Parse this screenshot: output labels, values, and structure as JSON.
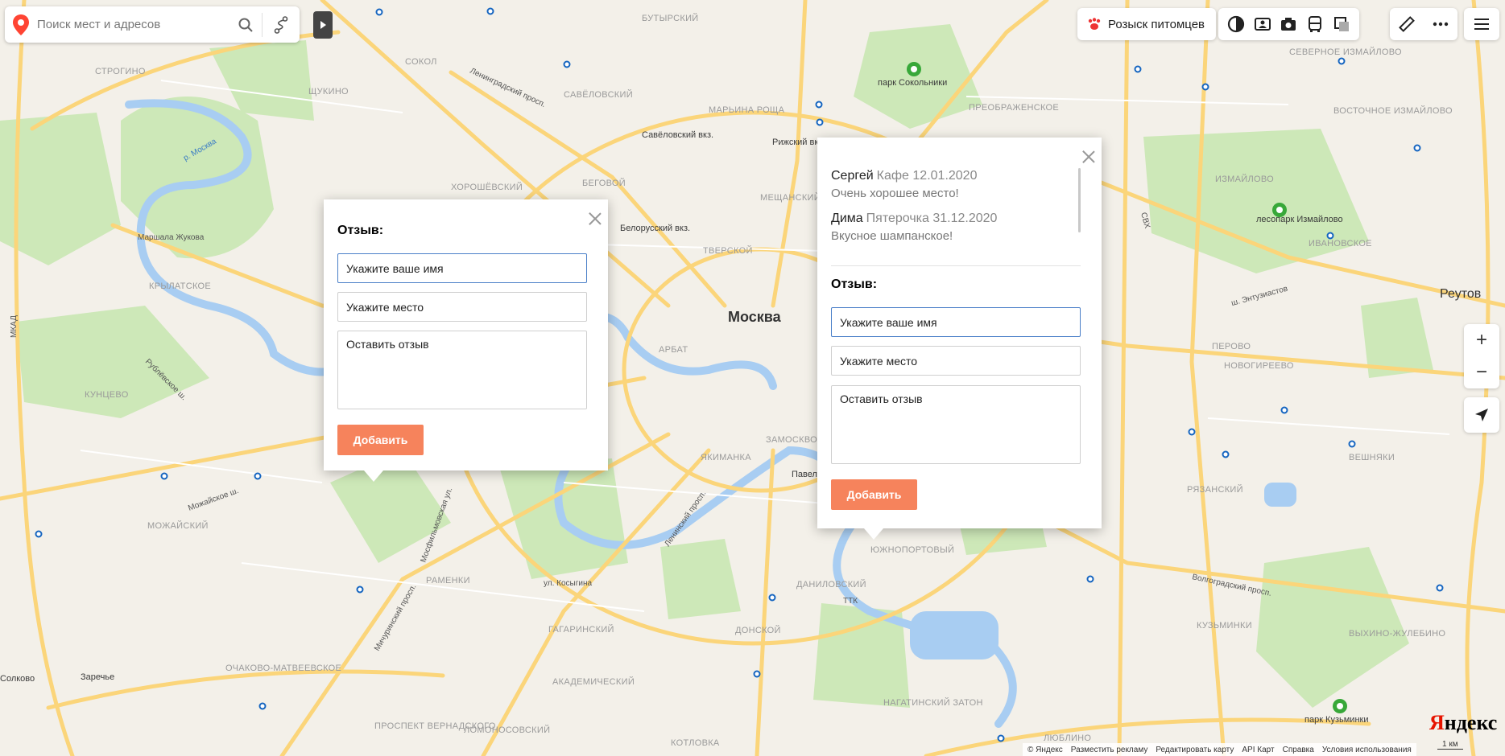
{
  "search": {
    "placeholder": "Поиск мест и адресов"
  },
  "top_right": {
    "pets_label": "Розыск питомцев"
  },
  "map": {
    "city_label": "Москва",
    "district_labels": [
      "СТРОГИНО",
      "ЩУКИНО",
      "СОКОЛ",
      "САВЁЛОВСКИЙ",
      "МАРЬИНА РОЩА",
      "БУТЫРСКИЙ",
      "СЕВЕРНОЕ ИЗМАЙЛОВО",
      "ХОРОШЁВСКИЙ",
      "БЕГОВОЙ",
      "МЕЩАНСКИЙ",
      "ТВЕРСКОЙ",
      "ПРЕОБРАЖЕНСКОЕ",
      "ВОСТОЧНОЕ ИЗМАЙЛОВО",
      "ИЗМАЙЛОВО",
      "ИВАНОВСКОЕ",
      "КРЫЛАТСКОЕ",
      "АРБАТ",
      "КУНЦЕВО",
      "ЯКИМАНКА",
      "ЗАМОСКВОРЕЧЬЕ",
      "ПЕРОВО",
      "НОВОГИРЕЕВО",
      "ВЕШНЯКИ",
      "РЯЗАНСКИЙ",
      "МОЖАЙСКИЙ",
      "РАМЕНКИ",
      "ГАГАРИНСКИЙ",
      "ДАНИЛОВСКИЙ",
      "ДОНСКОЙ",
      "ЮЖНОПОРТОВЫЙ",
      "КУЗЬМИНКИ",
      "ВЫХИНО-ЖУЛЕБИНО",
      "АКАДЕМИЧЕСКИЙ",
      "ОЧАКОВО-МАТВЕЕВСКОЕ",
      "ПРОСПЕКТ ВЕРНАДСКОГО",
      "ЛОМОНОСОВСКИЙ",
      "КОТЛОВКА",
      "НАГАТИНСКИЙ ЗАТОН",
      "ЛЮБЛИНО"
    ],
    "poi_labels": [
      "парк Сокольники",
      "лесопарк Измайлово",
      "парк Кузьминки",
      "Савёловский вкз.",
      "Рижский вкз.",
      "Белорусский вкз.",
      "Реутов",
      "Заречье",
      "Солково",
      "Павелецкий"
    ],
    "street_labels": [
      "Маршала Жукова",
      "МКАД",
      "ТТК",
      "СВХ",
      "р. Москва",
      "Ленинградский просп.",
      "Мичуринский просп.",
      "Ленинский просп.",
      "ш. Энтузиастов",
      "Волгоградский просп.",
      "Можайское ш.",
      "Рублёвское ш.",
      "ул. Косыгина",
      "Мосфильмовская ул."
    ]
  },
  "balloon_left": {
    "heading": "Отзыв:",
    "name_placeholder": "Укажите ваше имя",
    "place_placeholder": "Укажите место",
    "review_placeholder": "Оставить отзыв",
    "add_label": "Добавить"
  },
  "balloon_right": {
    "reviews": [
      {
        "author": "Сергей",
        "meta": "Кафе 12.01.2020",
        "text": "Очень хорошее место!"
      },
      {
        "author": "Дима",
        "meta": "Пятерочка 31.12.2020",
        "text": "Вкусное шампанское!"
      }
    ],
    "heading": "Отзыв:",
    "name_placeholder": "Укажите ваше имя",
    "place_placeholder": "Укажите место",
    "review_placeholder": "Оставить отзыв",
    "add_label": "Добавить"
  },
  "footer": {
    "links": [
      "© Яндекс",
      "Разместить рекламу",
      "Редактировать карту",
      "API Карт",
      "Справка",
      "Условия использования"
    ],
    "logo_first": "Я",
    "logo_rest": "ндекс",
    "scale": "1 км"
  },
  "colors": {
    "accent_button": "#f6835c",
    "focus_border": "#4a7fc8",
    "park": "#c9e7b4",
    "water": "#a6cbf0",
    "road": "#fbd57a"
  }
}
